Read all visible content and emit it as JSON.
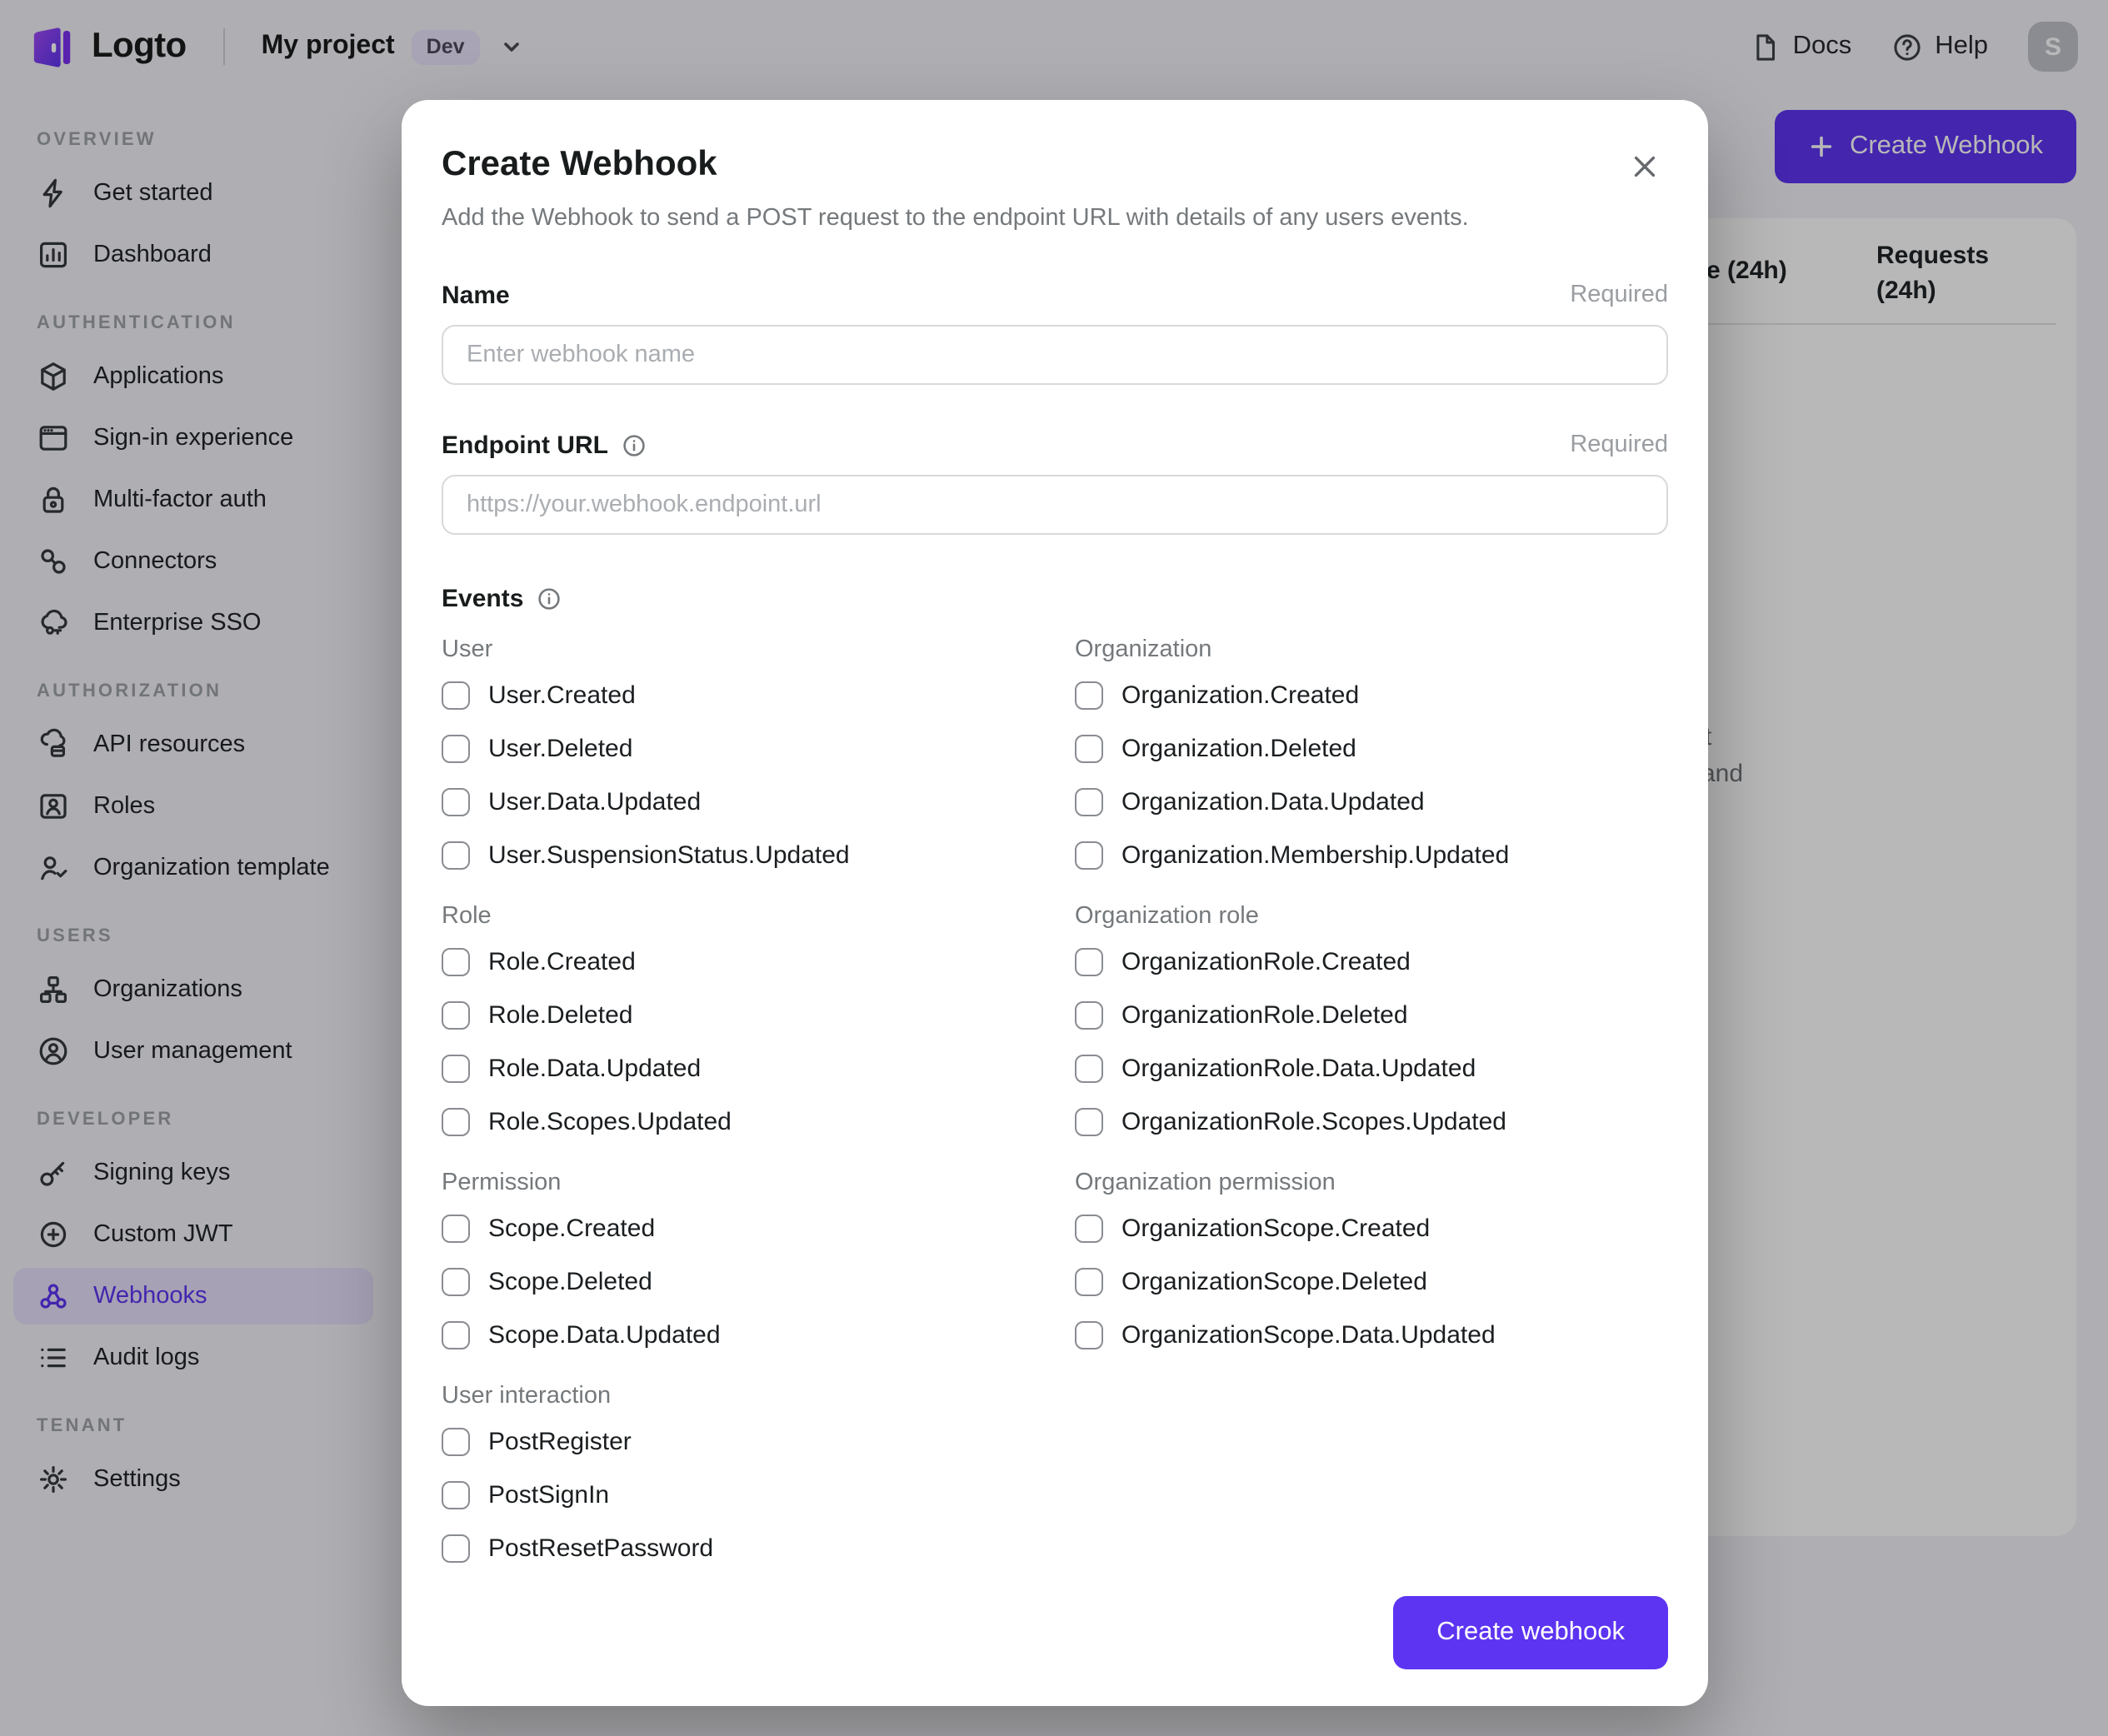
{
  "colors": {
    "accent": "#5d34f2"
  },
  "topbar": {
    "logo_text": "Logto",
    "project_name": "My project",
    "env_badge": "Dev",
    "docs": "Docs",
    "help": "Help",
    "avatar_initial": "S"
  },
  "sidebar": {
    "sections": [
      {
        "label": "OVERVIEW",
        "items": [
          {
            "label": "Get started",
            "icon": "lightning-icon"
          },
          {
            "label": "Dashboard",
            "icon": "dashboard-icon"
          }
        ]
      },
      {
        "label": "AUTHENTICATION",
        "items": [
          {
            "label": "Applications",
            "icon": "applications-cube-icon"
          },
          {
            "label": "Sign-in experience",
            "icon": "browser-window-icon"
          },
          {
            "label": "Multi-factor auth",
            "icon": "lock-icon"
          },
          {
            "label": "Connectors",
            "icon": "connectors-icon"
          },
          {
            "label": "Enterprise SSO",
            "icon": "cloud-key-icon"
          }
        ]
      },
      {
        "label": "AUTHORIZATION",
        "items": [
          {
            "label": "API resources",
            "icon": "cloud-box-icon"
          },
          {
            "label": "Roles",
            "icon": "role-card-icon"
          },
          {
            "label": "Organization template",
            "icon": "person-check-icon"
          }
        ]
      },
      {
        "label": "USERS",
        "items": [
          {
            "label": "Organizations",
            "icon": "org-chart-icon"
          },
          {
            "label": "User management",
            "icon": "user-circle-icon"
          }
        ]
      },
      {
        "label": "DEVELOPER",
        "items": [
          {
            "label": "Signing keys",
            "icon": "key-icon"
          },
          {
            "label": "Custom JWT",
            "icon": "seal-plus-icon"
          },
          {
            "label": "Webhooks",
            "icon": "webhook-icon"
          },
          {
            "label": "Audit logs",
            "icon": "list-lines-icon"
          }
        ]
      },
      {
        "label": "TENANT",
        "items": [
          {
            "label": "Settings",
            "icon": "gear-icon"
          }
        ]
      }
    ]
  },
  "page": {
    "create_button": "Create Webhook",
    "table_headers": {
      "partial": "e (24h)",
      "requests": "Requests (24h)"
    },
    "fragments": {
      "line1": "t",
      "line2": "and"
    }
  },
  "modal": {
    "title": "Create Webhook",
    "subtitle": "Add the Webhook to send a POST request to the endpoint URL with details of any users events.",
    "required_label": "Required",
    "name_field": {
      "label": "Name",
      "placeholder": "Enter webhook name"
    },
    "endpoint_field": {
      "label": "Endpoint URL",
      "placeholder": "https://your.webhook.endpoint.url"
    },
    "events_label": "Events",
    "event_groups": [
      {
        "label": "User",
        "options": [
          "User.Created",
          "User.Deleted",
          "User.Data.Updated",
          "User.SuspensionStatus.Updated"
        ]
      },
      {
        "label": "Organization",
        "options": [
          "Organization.Created",
          "Organization.Deleted",
          "Organization.Data.Updated",
          "Organization.Membership.Updated"
        ]
      },
      {
        "label": "Role",
        "options": [
          "Role.Created",
          "Role.Deleted",
          "Role.Data.Updated",
          "Role.Scopes.Updated"
        ]
      },
      {
        "label": "Organization role",
        "options": [
          "OrganizationRole.Created",
          "OrganizationRole.Deleted",
          "OrganizationRole.Data.Updated",
          "OrganizationRole.Scopes.Updated"
        ]
      },
      {
        "label": "Permission",
        "options": [
          "Scope.Created",
          "Scope.Deleted",
          "Scope.Data.Updated"
        ]
      },
      {
        "label": "Organization permission",
        "options": [
          "OrganizationScope.Created",
          "OrganizationScope.Deleted",
          "OrganizationScope.Data.Updated"
        ]
      },
      {
        "label": "User interaction",
        "options": [
          "PostRegister",
          "PostSignIn",
          "PostResetPassword"
        ]
      }
    ],
    "submit_button": "Create webhook"
  }
}
